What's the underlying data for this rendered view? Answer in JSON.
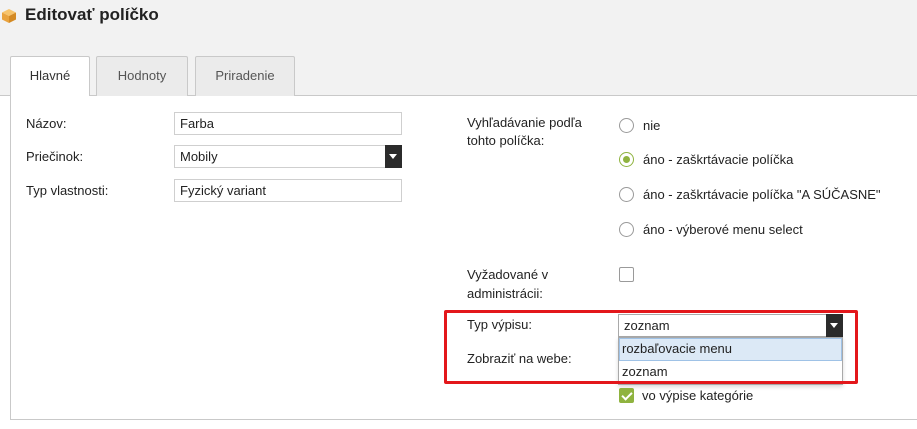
{
  "header": {
    "title": "Editovať políčko"
  },
  "tabs": [
    {
      "label": "Hlavné",
      "active": true
    },
    {
      "label": "Hodnoty",
      "active": false
    },
    {
      "label": "Priradenie",
      "active": false
    }
  ],
  "form": {
    "name": {
      "label": "Názov:",
      "value": "Farba"
    },
    "folder": {
      "label": "Priečinok:",
      "value": "Mobily"
    },
    "property_type": {
      "label": "Typ vlastnosti:",
      "value": "Fyzický variant"
    },
    "search": {
      "label_line1": "Vyhľadávanie podľa",
      "label_line2": "tohto políčka:",
      "options": [
        {
          "label": "nie",
          "checked": false
        },
        {
          "label": "áno - zaškrtávacie políčka",
          "checked": true
        },
        {
          "label": "áno - zaškrtávacie políčka \"A SÚČASNE\"",
          "checked": false
        },
        {
          "label": "áno - výberové menu select",
          "checked": false
        }
      ]
    },
    "required": {
      "label_line1": "Vyžadované v",
      "label_line2": "administrácii:",
      "checked": false
    },
    "listing_type": {
      "label": "Typ výpisu:",
      "value": "zoznam",
      "options": [
        {
          "label": "rozbaľovacie menu",
          "hovered": true
        },
        {
          "label": "zoznam",
          "hovered": false
        }
      ]
    },
    "show_on_web": {
      "label": "Zobraziť na webe:"
    },
    "category_listing": {
      "label": "vo výpise kategórie",
      "checked": true
    }
  },
  "colors": {
    "accent_green": "#8fb33f",
    "highlight_red": "#e3171b",
    "header_bg": "#f2f2f2"
  },
  "icons": {
    "app": "package-box-icon",
    "select_arrow": "chevron-down-icon"
  }
}
